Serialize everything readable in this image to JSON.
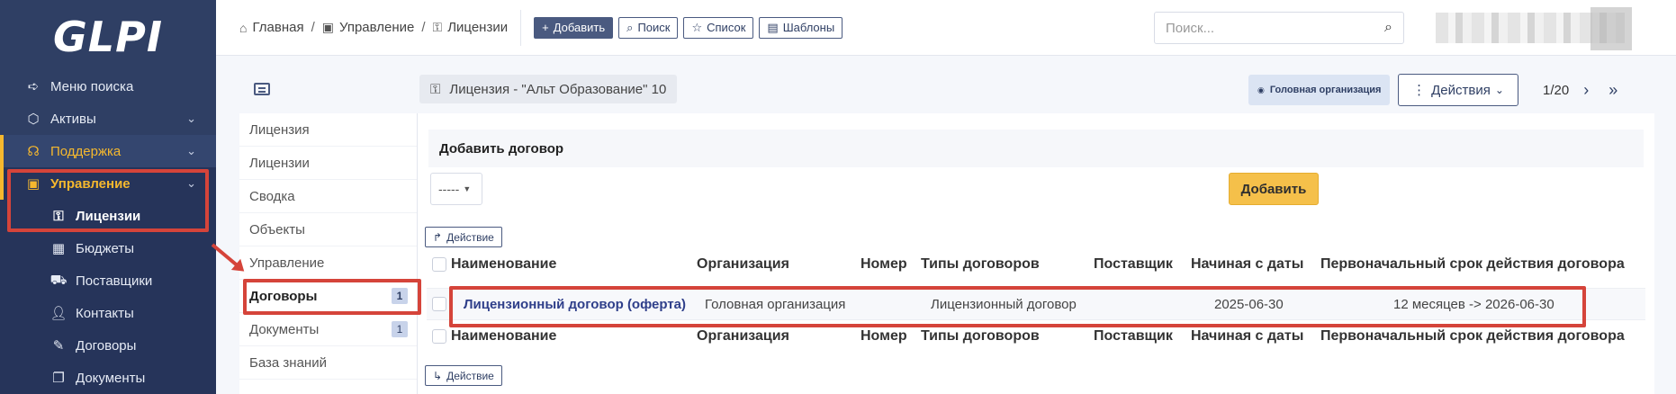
{
  "app": {
    "logo": "GLPI"
  },
  "sidebar": {
    "items": [
      {
        "icon": "arrow-right-icon",
        "label": "Меню поиска"
      },
      {
        "icon": "cube-icon",
        "label": "Активы"
      },
      {
        "icon": "headset-icon",
        "label": "Поддержка"
      },
      {
        "icon": "wallet-icon",
        "label": "Управление"
      }
    ],
    "sub_items": [
      {
        "icon": "key-icon",
        "label": "Лицензии"
      },
      {
        "icon": "calculator-icon",
        "label": "Бюджеты"
      },
      {
        "icon": "truck-icon",
        "label": "Поставщики"
      },
      {
        "icon": "user-icon",
        "label": "Контакты"
      },
      {
        "icon": "contract-icon",
        "label": "Договоры"
      },
      {
        "icon": "documents-icon",
        "label": "Документы"
      }
    ]
  },
  "header": {
    "breadcrumb": [
      {
        "icon": "home-icon",
        "label": "Главная"
      },
      {
        "icon": "wallet-icon",
        "label": "Управление"
      },
      {
        "icon": "key-icon",
        "label": "Лицензии"
      }
    ],
    "buttons": {
      "add": "Добавить",
      "search": "Поиск",
      "list": "Список",
      "templates": "Шаблоны"
    },
    "search_placeholder": "Поиск..."
  },
  "object": {
    "title": "Лицензия - \"Альт Образование\" 10",
    "entity": "Головная организация",
    "actions": "Действия",
    "pager": "1/20"
  },
  "tabs": [
    {
      "label": "Лицензия",
      "count": ""
    },
    {
      "label": "Лицензии",
      "count": ""
    },
    {
      "label": "Сводка",
      "count": ""
    },
    {
      "label": "Объекты",
      "count": ""
    },
    {
      "label": "Управление",
      "count": ""
    },
    {
      "label": "Договоры",
      "count": "1"
    },
    {
      "label": "Документы",
      "count": "1"
    },
    {
      "label": "База знаний",
      "count": ""
    }
  ],
  "contract_form": {
    "heading": "Добавить договор",
    "dropdown_value": "-----",
    "add_button": "Добавить",
    "mass_action": "Действие"
  },
  "table": {
    "columns": [
      "Наименование",
      "Организация",
      "Номер",
      "Типы договоров",
      "Поставщик",
      "Начиная с даты",
      "Первоначальный срок действия договора"
    ],
    "rows": [
      {
        "name": "Лицензионный договор (оферта)",
        "entity": "Головная организация",
        "number": "",
        "type": "Лицензионный договор",
        "supplier": "",
        "begin_date": "2025-06-30",
        "duration": "12 месяцев -> 2026-06-30"
      }
    ]
  }
}
